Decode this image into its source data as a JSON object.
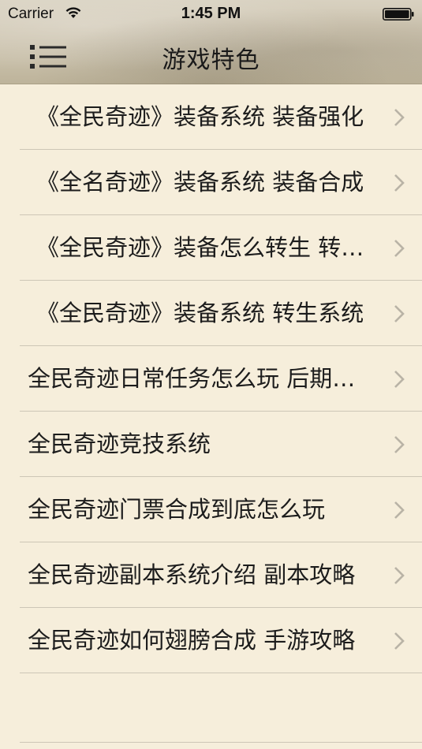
{
  "status_bar": {
    "carrier": "Carrier",
    "time": "1:45 PM"
  },
  "nav_bar": {
    "title": "游戏特色",
    "menu_icon": "list-menu-icon"
  },
  "colors": {
    "background": "#f6eedb",
    "separator": "#cdc6b6",
    "chevron": "#b9b3a6",
    "text": "#1c1c1c"
  },
  "list": {
    "items": [
      {
        "label": "《全民奇迹》装备系统 装备强化"
      },
      {
        "label": "《全名奇迹》装备系统 装备合成"
      },
      {
        "label": "《全民奇迹》装备怎么转生 转生攻略"
      },
      {
        "label": "《全民奇迹》装备系统 转生系统"
      },
      {
        "label": "全民奇迹日常任务怎么玩 后期攻略"
      },
      {
        "label": "全民奇迹竞技系统"
      },
      {
        "label": "全民奇迹门票合成到底怎么玩"
      },
      {
        "label": "全民奇迹副本系统介绍 副本攻略"
      },
      {
        "label": "全民奇迹如何翅膀合成 手游攻略"
      }
    ]
  }
}
